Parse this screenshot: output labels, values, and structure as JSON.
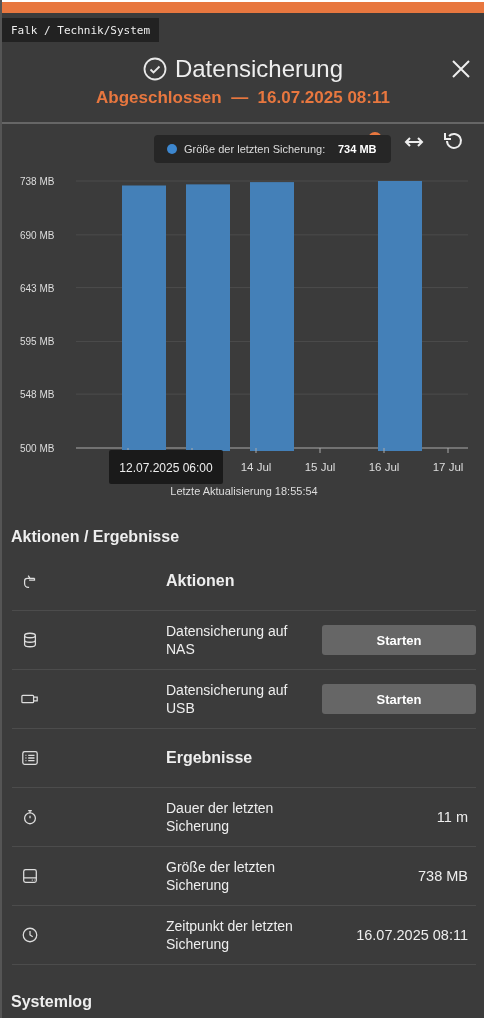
{
  "breadcrumb": "Falk / Technik/System",
  "title": "Datensicherung",
  "status": {
    "state": "Abgeschlossen",
    "separator": "—",
    "date": "16.07.2025 08:11"
  },
  "chart": {
    "legend_tooltip": {
      "label": "Größe der letzten Sicherung:",
      "value": "734 MB",
      "color": "#3d87cf"
    },
    "x_tooltip": "12.07.2025 06:00",
    "footer": "Letzte Aktualisierung 18:55:54",
    "chart_data": {
      "type": "bar",
      "categories": [
        null,
        null,
        "14 Jul",
        "15 Jul",
        "16 Jul",
        "17 Jul"
      ],
      "values": [
        734,
        735,
        737,
        null,
        738,
        null
      ],
      "ylim": [
        500,
        738
      ],
      "grid": true,
      "yticks": [
        {
          "value": 500,
          "label": "500 MB"
        },
        {
          "value": 548,
          "label": "548 MB"
        },
        {
          "value": 595,
          "label": "595 MB"
        },
        {
          "value": 643,
          "label": "643 MB"
        },
        {
          "value": 690,
          "label": "690 MB"
        },
        {
          "value": 738,
          "label": "738 MB"
        }
      ]
    }
  },
  "section_title": "Aktionen / Ergebnisse",
  "rows": [
    {
      "kind": "header",
      "label": "Aktionen"
    },
    {
      "kind": "action",
      "label": "Datensicherung auf NAS",
      "button": "Starten"
    },
    {
      "kind": "action",
      "label": "Datensicherung auf USB",
      "button": "Starten"
    },
    {
      "kind": "header",
      "label": "Ergebnisse"
    },
    {
      "kind": "value",
      "label": "Dauer der letzten Sicherung",
      "value": "11 m"
    },
    {
      "kind": "value",
      "label": "Größe der letzten Sicherung",
      "value": "738 MB"
    },
    {
      "kind": "value",
      "label": "Zeitpunkt der letzten Sicherung",
      "value": "16.07.2025 08:11"
    }
  ],
  "next_section": "Systemlog"
}
